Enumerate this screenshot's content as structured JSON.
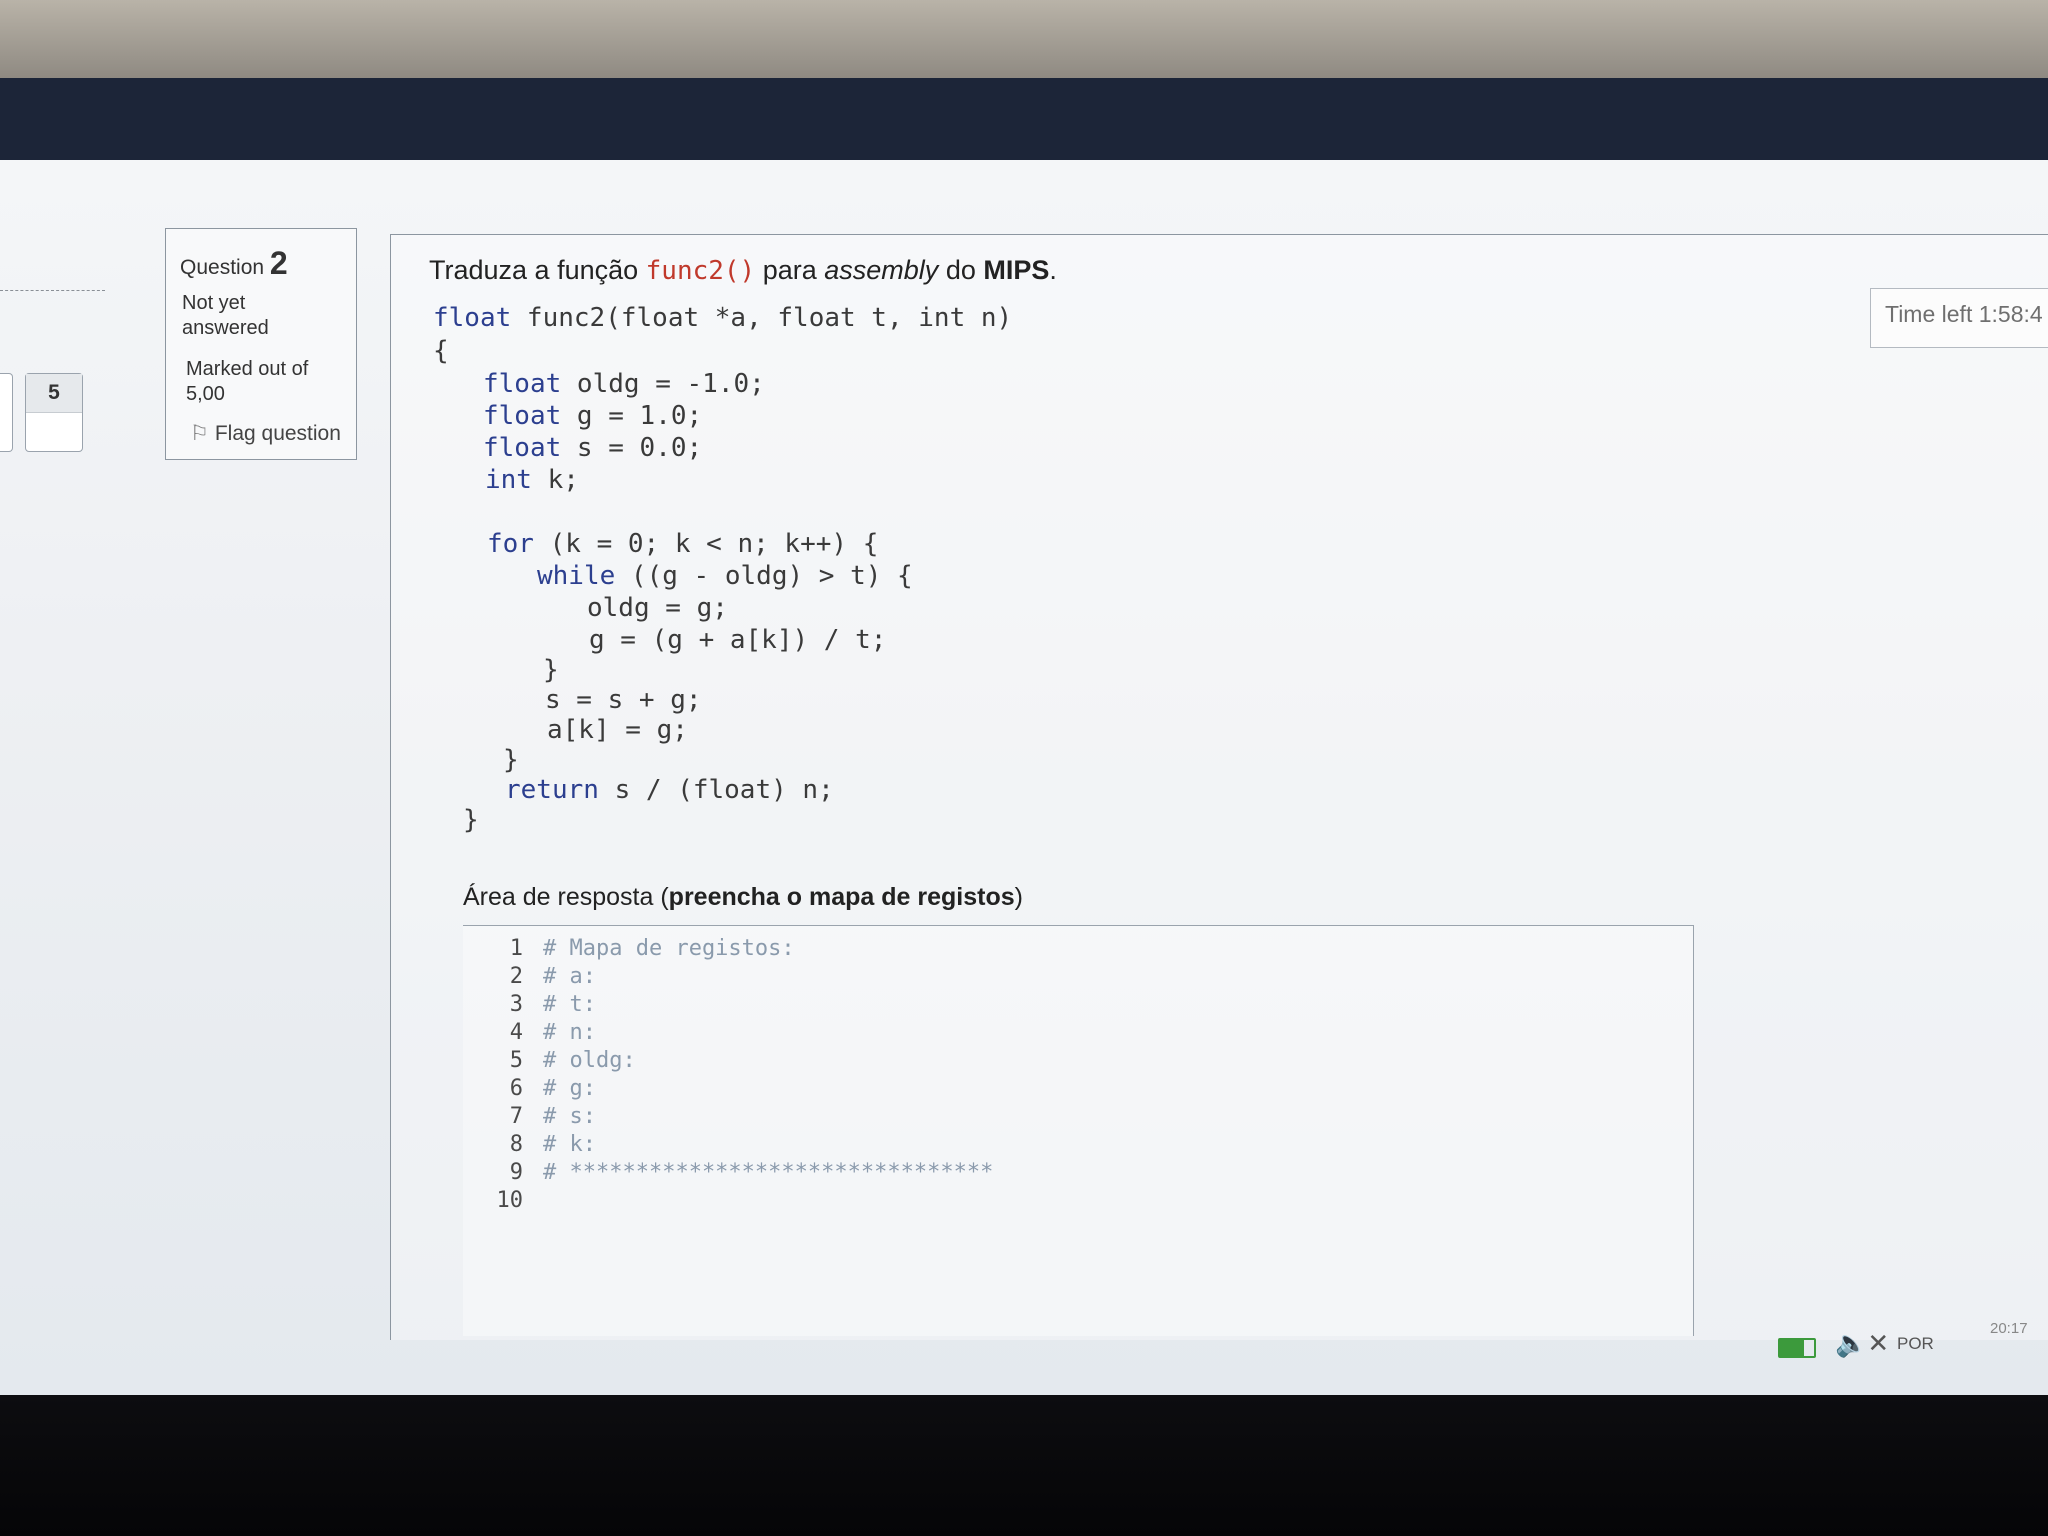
{
  "question": {
    "label": "Question",
    "number": "2",
    "state": "Not yet answered",
    "marks_label": "Marked out of",
    "marks_value": "5,00",
    "flag_label": "Flag question"
  },
  "navigation": {
    "tile_number": "5"
  },
  "prompt": {
    "before": "Traduza a função ",
    "func": "func2()",
    "middle": " para ",
    "italic": "assembly",
    "after": " do ",
    "bold": "MIPS",
    "end": "."
  },
  "code": [
    {
      "kw": "float",
      "rest": " func2(float *a, float t, int n)"
    },
    {
      "kw": "",
      "rest": "{"
    },
    {
      "kw": "float",
      "rest": " oldg = -1.0;"
    },
    {
      "kw": "float",
      "rest": " g = 1.0;"
    },
    {
      "kw": "float",
      "rest": " s = 0.0;"
    },
    {
      "kw": "int",
      "rest": " k;"
    },
    {
      "kw": "for",
      "rest": " (k = 0; k < n; k++) {"
    },
    {
      "kw": "while",
      "rest": " ((g - oldg) > t) {"
    },
    {
      "kw": "",
      "rest": "oldg = g;"
    },
    {
      "kw": "",
      "rest": "g = (g + a[k]) / t;"
    },
    {
      "kw": "",
      "rest": "}"
    },
    {
      "kw": "",
      "rest": "s = s + g;"
    },
    {
      "kw": "",
      "rest": "a[k] = g;"
    },
    {
      "kw": "",
      "rest": "}"
    },
    {
      "kw": "return",
      "rest": " s / (float) n;"
    },
    {
      "kw": "",
      "rest": "}"
    }
  ],
  "answer": {
    "label_before": "Área de resposta (",
    "label_bold": "preencha o mapa de registos",
    "label_after": ")"
  },
  "editor_lines": [
    {
      "n": "1",
      "t": "# Mapa de registos:"
    },
    {
      "n": "2",
      "t": "# a:"
    },
    {
      "n": "3",
      "t": "# t:"
    },
    {
      "n": "4",
      "t": "# n:"
    },
    {
      "n": "5",
      "t": "# oldg:"
    },
    {
      "n": "6",
      "t": "# g:"
    },
    {
      "n": "7",
      "t": "# s:"
    },
    {
      "n": "8",
      "t": "# k:"
    },
    {
      "n": "9",
      "t": "# ********************************"
    },
    {
      "n": "10",
      "t": ""
    }
  ],
  "timer": {
    "text": "Time left 1:58:4"
  },
  "taskbar": {
    "language": "POR",
    "clock": "20:17"
  },
  "icons": [
    "flag-icon",
    "battery-icon",
    "speaker-muted-icon"
  ]
}
